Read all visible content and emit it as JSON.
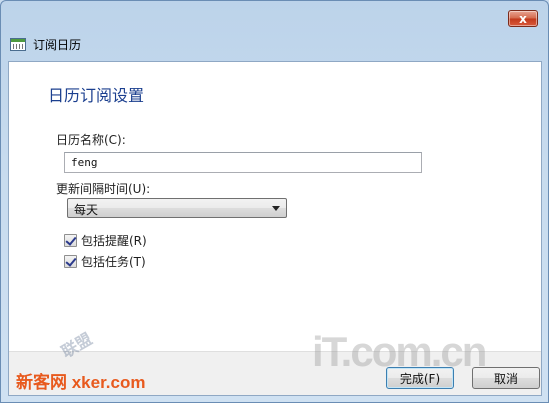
{
  "window": {
    "title": "订阅日历",
    "close_glyph": "x"
  },
  "dialog": {
    "heading": "日历订阅设置",
    "calendar_name_label": "日历名称(C):",
    "calendar_name_value": "feng",
    "update_interval_label": "更新间隔时间(U):",
    "update_interval_value": "每天",
    "include_reminders": {
      "label": "包括提醒(R)",
      "checked": true
    },
    "include_tasks": {
      "label": "包括任务(T)",
      "checked": true
    }
  },
  "footer": {
    "finish_label": "完成(F)",
    "cancel_label": "取消"
  },
  "watermarks": {
    "left_text": "新客网 xker.com",
    "left_sub": "联盟",
    "right_text": "iT.com.cn"
  },
  "colors": {
    "heading": "#1b3f8f",
    "close": "#c2391c",
    "chrome": "#c7dbee"
  }
}
